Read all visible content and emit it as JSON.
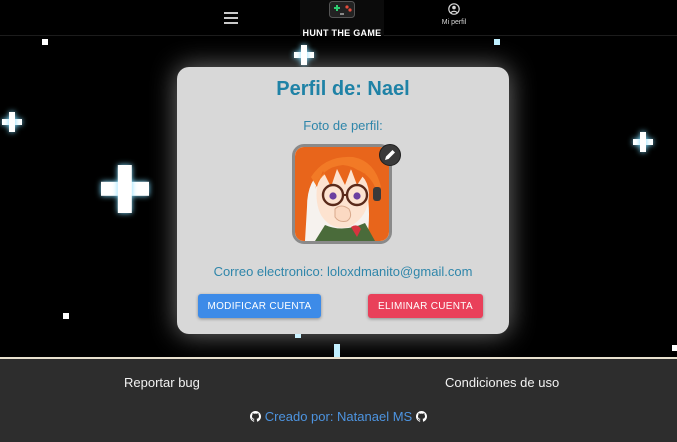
{
  "header": {
    "menu_icon": "hamburger-icon",
    "logo_text": "HUNT THE GAME",
    "logo_icon": "gamepad-icon",
    "profile_label": "Mi perfil",
    "profile_icon": "user-circle-icon"
  },
  "profile": {
    "title": "Perfil de: Nael",
    "photo_label": "Foto de perfil:",
    "avatar_icon": "anime-avatar-image",
    "edit_icon": "pencil-icon",
    "email_text": "Correo electronico: loloxdmanito@gmail.com",
    "edit_button": "MODIFICAR CUENTA",
    "delete_button": "ELIMINAR CUENTA"
  },
  "footer": {
    "report_bug": "Reportar bug",
    "terms": "Condiciones de uso",
    "credit": "Creado por: Natanael MS",
    "credit_icon": "github-icon"
  },
  "colors": {
    "title": "#1f82a6",
    "text": "#2f86aa",
    "edit_button": "#3d8be8",
    "delete_button": "#e9405a",
    "footer_bg": "#2d2d2d",
    "card_bg": "#d8d8d8"
  }
}
